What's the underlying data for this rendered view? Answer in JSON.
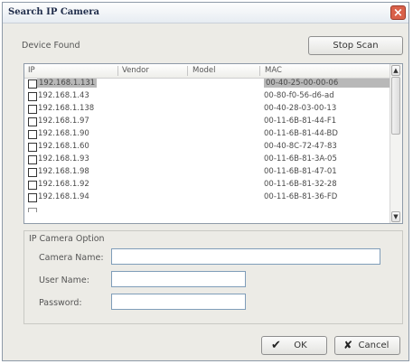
{
  "window": {
    "title": "Search IP Camera",
    "close_glyph": "×"
  },
  "device_found_label": "Device Found",
  "stop_scan_label": "Stop Scan",
  "table": {
    "columns": [
      "IP",
      "Vendor",
      "Model",
      "MAC"
    ],
    "rows": [
      {
        "ip": "192.168.1.131",
        "mac": "00-40-25-00-00-06",
        "selected": true
      },
      {
        "ip": "192.168.1.43",
        "mac": "00-80-f0-56-d6-ad",
        "selected": false
      },
      {
        "ip": "192.168.1.138",
        "mac": "00-40-28-03-00-13",
        "selected": false
      },
      {
        "ip": "192.168.1.97",
        "mac": "00-11-6B-81-44-F1",
        "selected": false
      },
      {
        "ip": "192.168.1.90",
        "mac": "00-11-6B-81-44-BD",
        "selected": false
      },
      {
        "ip": "192.168.1.60",
        "mac": "00-40-8C-72-47-83",
        "selected": false
      },
      {
        "ip": "192.168.1.93",
        "mac": "00-11-6B-81-3A-05",
        "selected": false
      },
      {
        "ip": "192.168.1.98",
        "mac": "00-11-6B-81-47-01",
        "selected": false
      },
      {
        "ip": "192.168.1.92",
        "mac": "00-11-6B-81-32-28",
        "selected": false
      },
      {
        "ip": "192.168.1.94",
        "mac": "00-11-6B-81-36-FD",
        "selected": false
      }
    ]
  },
  "option_group": {
    "title": "IP Camera Option",
    "camera_name_label": "Camera Name:",
    "user_name_label": "User Name:",
    "password_label": "Password:",
    "camera_name_value": "",
    "user_name_value": "",
    "password_value": ""
  },
  "ok_label": "OK",
  "cancel_label": "Cancel",
  "icons": {
    "scroll_up": "▲",
    "scroll_down": "▼",
    "ok": "check-icon",
    "cancel": "x-icon"
  }
}
